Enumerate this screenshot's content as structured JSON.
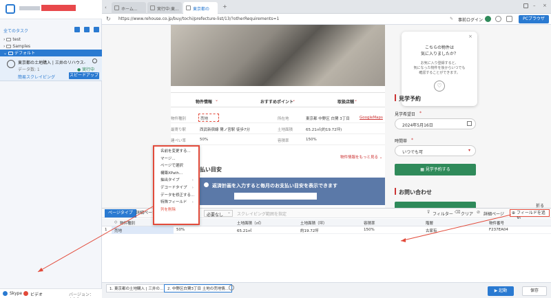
{
  "sidebar": {
    "all_tasks": "全てのタスク",
    "tree": [
      "test",
      "Samples",
      "デフォルト"
    ],
    "task_title": "東京都の土地購入 | 三井のリハウス-",
    "task_sub": "データ数: 1",
    "task_status": "● 実行中",
    "task_mode": "簡易スクレイピング",
    "speed_up": "スピードアップ",
    "footer_skype": "Skype",
    "footer_video": "ビデオ",
    "version": "バージョン：4.0.2"
  },
  "browser": {
    "tabs": [
      "ホーム...",
      "実行中:東...",
      "東京都の"
    ],
    "url": "https://www.rehouse.co.jp/buy/tochi/prefecture-list/13/?otherRequirements=1",
    "login_label": "事前ログイン",
    "pc_browser": "PCブラウザ"
  },
  "page": {
    "popup": {
      "title_1": "こちらの物件は",
      "title_2": "気に入りましたか？",
      "desc_1": "お気に入り登録すると、",
      "desc_2": "気になった物件を後からいつでも",
      "desc_3": "確認することができます。"
    },
    "nav": [
      "物件情報",
      "おすすめポイント",
      "取扱店舗"
    ],
    "rows": [
      {
        "k1": "物件種別",
        "v1": "売地",
        "k2": "所在地",
        "v2": "東京都 中野区 白鷺 3丁目",
        "v2_link": "GoogleMaps"
      },
      {
        "k1": "最寄り駅",
        "v1": "西武新宿線 鷺ノ宮駅 徒歩7分",
        "k2": "土地面積",
        "v2": "65.21㎡(約19.72坪)",
        "v2_link": ""
      },
      {
        "k1": "建ぺい率",
        "v1": "50%",
        "k2": "容積率",
        "v2": "150%",
        "v2_link": ""
      }
    ],
    "more_link": "物件情報をもっと見る ⌄",
    "payment_title": "払い目安",
    "payment_banner": "返済計画を入力すると毎月のお支払い目安を表示できます",
    "visit": {
      "title": "見学予約",
      "date_label": "見学希望日",
      "date_value": "2024年5月16日",
      "time_label": "時間帯",
      "time_value": "いつでも可",
      "reserve_button": "見学予約する"
    },
    "inquiry_title": "お問い合わせ"
  },
  "context_menu": {
    "items": [
      {
        "label": "名前を変更する...",
        "arrow": ""
      },
      {
        "label": "マージ...",
        "arrow": ""
      },
      {
        "label": "ページで選択",
        "arrow": ""
      },
      {
        "label": "構築XPath...",
        "arrow": ""
      },
      {
        "label": "抽出タイプ",
        "arrow": "›"
      },
      {
        "label": "デコードタイプ",
        "arrow": "›"
      },
      {
        "label": "データを修正する...",
        "arrow": ""
      },
      {
        "label": "特殊フィールド",
        "arrow": "›"
      },
      {
        "label": "列を削除",
        "arrow": ""
      }
    ]
  },
  "panel": {
    "tabs": [
      "ページタイプ",
      "詳細ページ"
    ],
    "dropdown": "必要なし",
    "scrape_range": "スクレイピング範囲を指定",
    "filter": "フィルター",
    "clear": "クリア",
    "detail_link": "詳細ページ",
    "collapse": "折る",
    "add_field": "フィールドを追加",
    "columns": [
      "物件種別",
      "",
      "土地面積（㎡）",
      "土地面積（坪）",
      "容積率",
      "階層",
      "物件番号"
    ],
    "row": {
      "index": "1",
      "cells": [
        "売地",
        "50%",
        "65.21㎡",
        "約19.72坪",
        "150%",
        "古家有",
        "F237EA04"
      ]
    }
  },
  "bottom": {
    "tabs": [
      "1. 東京都の土地購入 | 三井の...",
      "2. 中野区白鷺3丁目 土地の売地情..."
    ],
    "start": "▶ 起動",
    "save": "保存"
  },
  "colors": {
    "accent": "#2a7ad1",
    "highlight": "#e24a3a",
    "green": "#2f8a5a"
  }
}
